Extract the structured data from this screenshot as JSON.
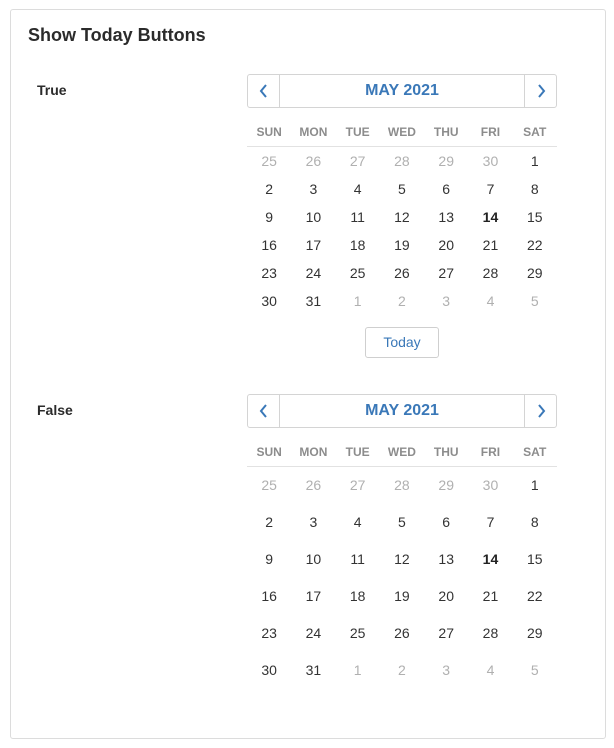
{
  "panel": {
    "title": "Show Today Buttons"
  },
  "calendars": [
    {
      "label": "True",
      "month_label": "MAY 2021",
      "today_label": "Today",
      "weekdays": [
        "SUN",
        "MON",
        "TUE",
        "WED",
        "THU",
        "FRI",
        "SAT"
      ],
      "weeks": [
        [
          {
            "d": "25",
            "m": true
          },
          {
            "d": "26",
            "m": true
          },
          {
            "d": "27",
            "m": true
          },
          {
            "d": "28",
            "m": true
          },
          {
            "d": "29",
            "m": true
          },
          {
            "d": "30",
            "m": true
          },
          {
            "d": "1"
          }
        ],
        [
          {
            "d": "2"
          },
          {
            "d": "3"
          },
          {
            "d": "4"
          },
          {
            "d": "5"
          },
          {
            "d": "6"
          },
          {
            "d": "7"
          },
          {
            "d": "8"
          }
        ],
        [
          {
            "d": "9"
          },
          {
            "d": "10"
          },
          {
            "d": "11"
          },
          {
            "d": "12"
          },
          {
            "d": "13"
          },
          {
            "d": "14",
            "t": true
          },
          {
            "d": "15"
          }
        ],
        [
          {
            "d": "16"
          },
          {
            "d": "17"
          },
          {
            "d": "18"
          },
          {
            "d": "19"
          },
          {
            "d": "20"
          },
          {
            "d": "21"
          },
          {
            "d": "22"
          }
        ],
        [
          {
            "d": "23"
          },
          {
            "d": "24"
          },
          {
            "d": "25"
          },
          {
            "d": "26"
          },
          {
            "d": "27"
          },
          {
            "d": "28"
          },
          {
            "d": "29"
          }
        ],
        [
          {
            "d": "30"
          },
          {
            "d": "31"
          },
          {
            "d": "1",
            "m": true
          },
          {
            "d": "2",
            "m": true
          },
          {
            "d": "3",
            "m": true
          },
          {
            "d": "4",
            "m": true
          },
          {
            "d": "5",
            "m": true
          }
        ]
      ]
    },
    {
      "label": "False",
      "month_label": "MAY 2021",
      "weekdays": [
        "SUN",
        "MON",
        "TUE",
        "WED",
        "THU",
        "FRI",
        "SAT"
      ],
      "weeks": [
        [
          {
            "d": "25",
            "m": true
          },
          {
            "d": "26",
            "m": true
          },
          {
            "d": "27",
            "m": true
          },
          {
            "d": "28",
            "m": true
          },
          {
            "d": "29",
            "m": true
          },
          {
            "d": "30",
            "m": true
          },
          {
            "d": "1"
          }
        ],
        [
          {
            "d": "2"
          },
          {
            "d": "3"
          },
          {
            "d": "4"
          },
          {
            "d": "5"
          },
          {
            "d": "6"
          },
          {
            "d": "7"
          },
          {
            "d": "8"
          }
        ],
        [
          {
            "d": "9"
          },
          {
            "d": "10"
          },
          {
            "d": "11"
          },
          {
            "d": "12"
          },
          {
            "d": "13"
          },
          {
            "d": "14",
            "t": true
          },
          {
            "d": "15"
          }
        ],
        [
          {
            "d": "16"
          },
          {
            "d": "17"
          },
          {
            "d": "18"
          },
          {
            "d": "19"
          },
          {
            "d": "20"
          },
          {
            "d": "21"
          },
          {
            "d": "22"
          }
        ],
        [
          {
            "d": "23"
          },
          {
            "d": "24"
          },
          {
            "d": "25"
          },
          {
            "d": "26"
          },
          {
            "d": "27"
          },
          {
            "d": "28"
          },
          {
            "d": "29"
          }
        ],
        [
          {
            "d": "30"
          },
          {
            "d": "31"
          },
          {
            "d": "1",
            "m": true
          },
          {
            "d": "2",
            "m": true
          },
          {
            "d": "3",
            "m": true
          },
          {
            "d": "4",
            "m": true
          },
          {
            "d": "5",
            "m": true
          }
        ]
      ]
    }
  ],
  "colors": {
    "accent": "#3a78b8",
    "muted_day": "#b0b0b0",
    "weekday": "#8c8c8c",
    "border": "#d4d4d4"
  },
  "icons": {
    "prev": "chevron-left-icon",
    "next": "chevron-right-icon"
  }
}
